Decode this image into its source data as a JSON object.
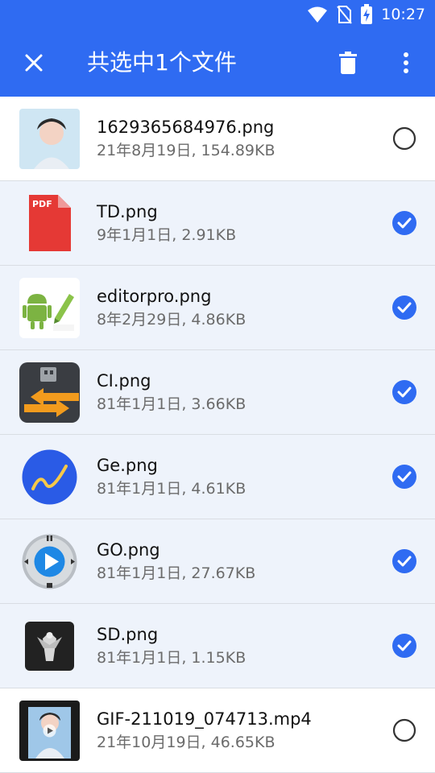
{
  "status_bar": {
    "time": "10:27"
  },
  "app_bar": {
    "title": "共选中1个文件"
  },
  "colors": {
    "primary": "#2f6bf2",
    "check": "#2f6bf2",
    "selected_row_bg": "#eef3fb"
  },
  "files": [
    {
      "name": "1629365684976.png",
      "meta": "21年8月19日, 154.89KB",
      "selected": false
    },
    {
      "name": "TD.png",
      "meta": "9年1月1日, 2.91KB",
      "selected": true
    },
    {
      "name": "editorpro.png",
      "meta": "8年2月29日, 4.86KB",
      "selected": true
    },
    {
      "name": "CI.png",
      "meta": "81年1月1日, 3.66KB",
      "selected": true
    },
    {
      "name": "Ge.png",
      "meta": "81年1月1日, 4.61KB",
      "selected": true
    },
    {
      "name": "GO.png",
      "meta": "81年1月1日, 27.67KB",
      "selected": true
    },
    {
      "name": "SD.png",
      "meta": "81年1月1日, 1.15KB",
      "selected": true
    },
    {
      "name": "GIF-211019_074713.mp4",
      "meta": "21年10月19日, 46.65KB",
      "selected": false
    }
  ]
}
